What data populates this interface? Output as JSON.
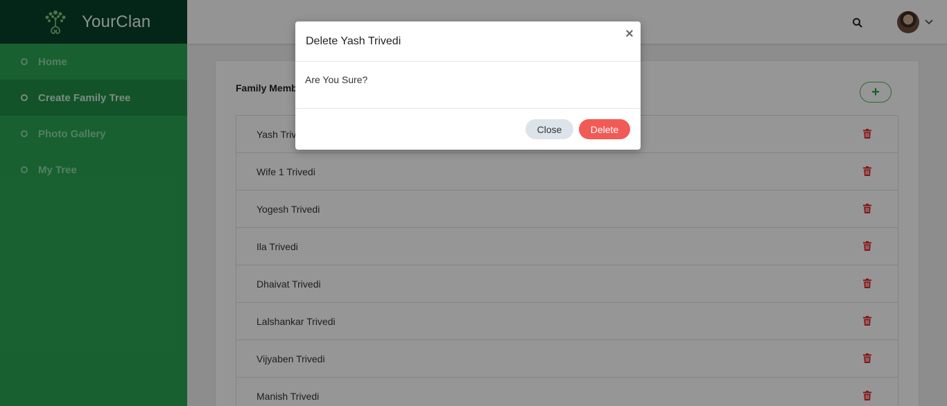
{
  "brand": {
    "name": "YourClan"
  },
  "sidebar": {
    "items": [
      {
        "label": "Home",
        "active": false
      },
      {
        "label": "Create Family Tree",
        "active": true
      },
      {
        "label": "Photo Gallery",
        "active": false
      },
      {
        "label": "My Tree",
        "active": false
      }
    ]
  },
  "header": {
    "search_icon": "search-icon",
    "avatar": "user-avatar",
    "menu_icon": "chevron-down-icon"
  },
  "main": {
    "section_title": "Family Membe",
    "add_button": "+",
    "members": [
      {
        "name": "Yash Triv"
      },
      {
        "name": "Wife 1 Trivedi"
      },
      {
        "name": "Yogesh Trivedi"
      },
      {
        "name": "Ila Trivedi"
      },
      {
        "name": "Dhaivat Trivedi"
      },
      {
        "name": "Lalshankar Trivedi"
      },
      {
        "name": "Vijyaben Trivedi"
      },
      {
        "name": "Manish Trivedi"
      }
    ]
  },
  "modal": {
    "title": "Delete Yash Trivedi",
    "close_x": "×",
    "body": "Are You Sure?",
    "close_label": "Close",
    "delete_label": "Delete"
  },
  "colors": {
    "sidebar_bg": "#2aa152",
    "brand_bg": "#05402a",
    "delete_red": "#f25a55",
    "trash_red": "#e02424"
  }
}
